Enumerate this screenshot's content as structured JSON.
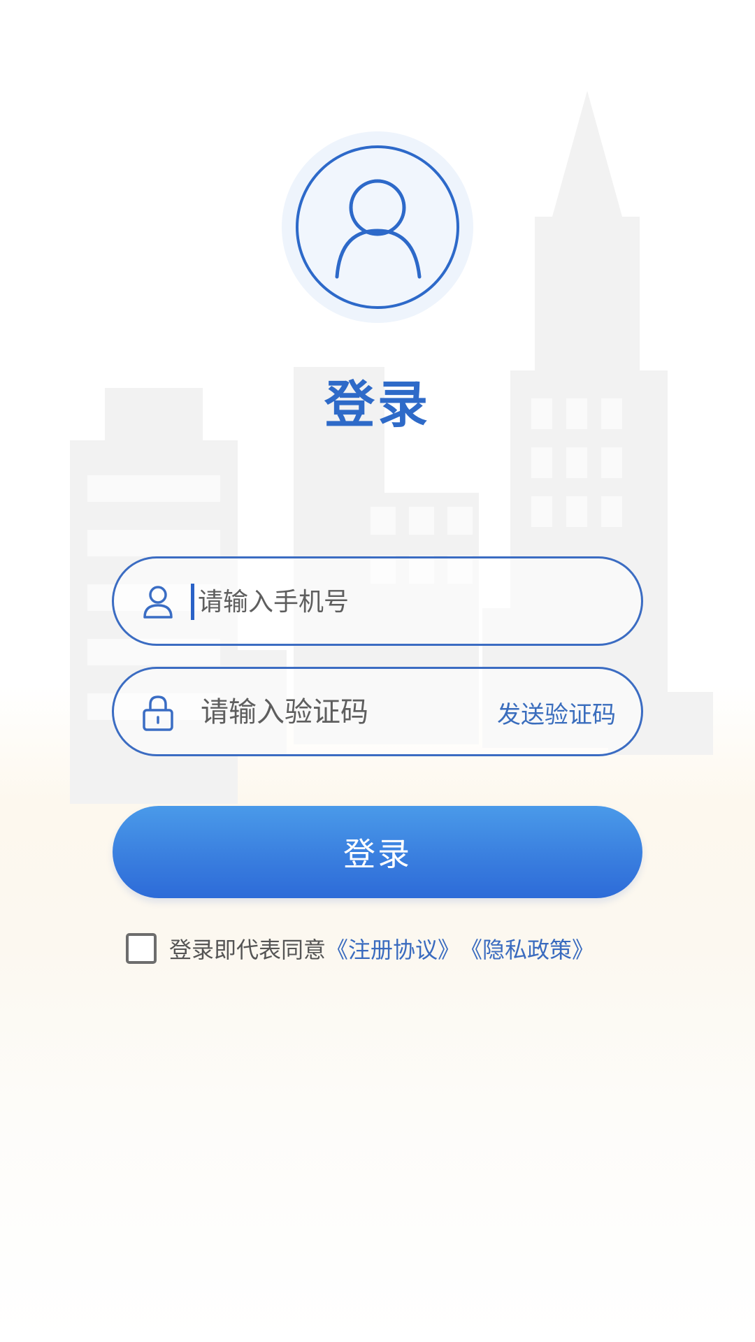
{
  "header": {
    "title": "登录"
  },
  "avatar": {
    "icon": "user-icon"
  },
  "form": {
    "phone": {
      "icon": "user-icon",
      "placeholder": "请输入手机号",
      "value": ""
    },
    "code": {
      "icon": "lock-icon",
      "placeholder": "请输入验证码",
      "value": "",
      "send_label": "发送验证码"
    },
    "submit_label": "登录"
  },
  "agreement": {
    "checked": false,
    "text": "登录即代表同意",
    "register_link": "《注册协议》",
    "privacy_link": "《隐私政策》"
  },
  "colors": {
    "accent": "#2e6ac8",
    "button_top": "#4a9ae9",
    "button_bottom": "#2d6bd8",
    "link": "#3a6bbf"
  }
}
